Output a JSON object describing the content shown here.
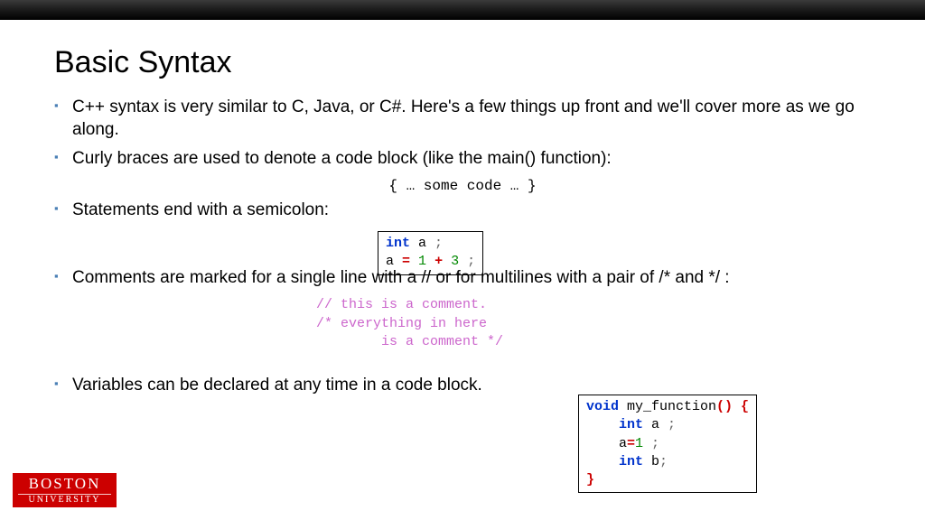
{
  "title": "Basic Syntax",
  "bullets": {
    "b1": "C++ syntax is very similar to C, Java, or C#.  Here's a few things up front and we'll cover more as we go along.",
    "b2": "Curly braces are used to denote a code block (like the main() function):",
    "b3": "Statements end with a semicolon:",
    "b4": "Comments are marked for a single line with a  // or for multilines with a pair of /* and */ :",
    "b5": "Variables can be declared at any time in a code block."
  },
  "code": {
    "braces": "{ … some code … }",
    "stmt_kw": "int",
    "stmt_var1": " a ",
    "stmt_semi": ";",
    "stmt_line2a": "a ",
    "stmt_eq": "=",
    "stmt_sp": " ",
    "stmt_n1": "1",
    "stmt_plus": "+",
    "stmt_n3": "3",
    "comments": "// this is a comment.\n/* everything in here\n        is a comment */",
    "fn_void": "void",
    "fn_name": " my_function",
    "fn_open": "() {",
    "fn_int": "int",
    "fn_a": " a ",
    "fn_semi": ";",
    "fn_aeq": "    a",
    "fn_eq": "=",
    "fn_1": "1",
    "fn_s2": " ;",
    "fn_int2": "int",
    "fn_b": " b",
    "fn_s3": ";",
    "fn_close": "}"
  },
  "logo": {
    "top": "BOSTON",
    "bottom": "UNIVERSITY"
  }
}
